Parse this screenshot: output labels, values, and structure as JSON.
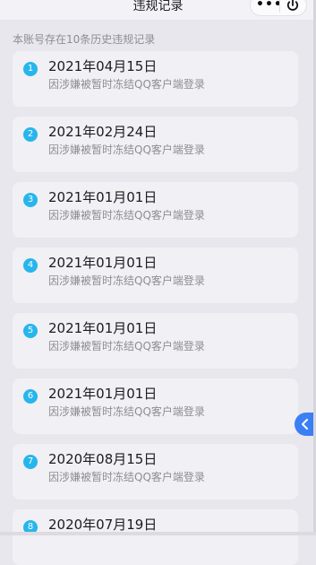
{
  "header": {
    "title": "违规记录",
    "more_label": "•••"
  },
  "summary": "本账号存在10条历史违规记录",
  "records": [
    {
      "index": "1",
      "date": "2021年04月15日",
      "desc": "因涉嫌被暂时冻结QQ客户端登录"
    },
    {
      "index": "2",
      "date": "2021年02月24日",
      "desc": "因涉嫌被暂时冻结QQ客户端登录"
    },
    {
      "index": "3",
      "date": "2021年01月01日",
      "desc": "因涉嫌被暂时冻结QQ客户端登录"
    },
    {
      "index": "4",
      "date": "2021年01月01日",
      "desc": "因涉嫌被暂时冻结QQ客户端登录"
    },
    {
      "index": "5",
      "date": "2021年01月01日",
      "desc": "因涉嫌被暂时冻结QQ客户端登录"
    },
    {
      "index": "6",
      "date": "2021年01月01日",
      "desc": "因涉嫌被暂时冻结QQ客户端登录"
    },
    {
      "index": "7",
      "date": "2020年08月15日",
      "desc": "因涉嫌被暂时冻结QQ客户端登录"
    },
    {
      "index": "8",
      "date": "2020年07月19日",
      "desc": ""
    }
  ],
  "icons": {
    "power": "power-icon",
    "sidetab": "chevron-left-icon"
  },
  "colors": {
    "badge": "#27b6ec",
    "sidetab": "#3b7ff5",
    "background": "#e8e7ed",
    "card": "#f1f0f5"
  }
}
